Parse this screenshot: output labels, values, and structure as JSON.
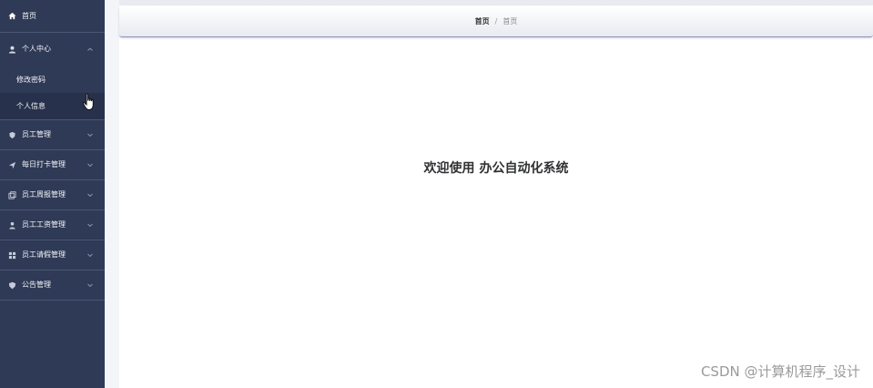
{
  "sidebar": {
    "home": {
      "label": "首页",
      "icon": "home-icon"
    },
    "personal_center": {
      "label": "个人中心",
      "icon": "user-icon",
      "expanded": true,
      "children": [
        {
          "label": "修改密码"
        },
        {
          "label": "个人信息",
          "active": true
        }
      ]
    },
    "items": [
      {
        "label": "员工管理",
        "icon": "badge-icon"
      },
      {
        "label": "每日打卡管理",
        "icon": "send-icon"
      },
      {
        "label": "员工周报管理",
        "icon": "copy-icon"
      },
      {
        "label": "员工工资管理",
        "icon": "person-icon"
      },
      {
        "label": "员工请假管理",
        "icon": "grid-icon"
      },
      {
        "label": "公告管理",
        "icon": "shield-icon"
      }
    ]
  },
  "breadcrumb": {
    "home": "首页",
    "separator": "/",
    "current": "首页"
  },
  "welcome": {
    "prefix": "欢迎使用",
    "system_name": "办公自动化系统"
  },
  "watermark": "CSDN @计算机程序_设计",
  "colors": {
    "sidebar_bg": "#2f3a56",
    "sidebar_active_bg": "#27314b",
    "header_border": "#8b93ba",
    "text_dark": "#303133"
  }
}
